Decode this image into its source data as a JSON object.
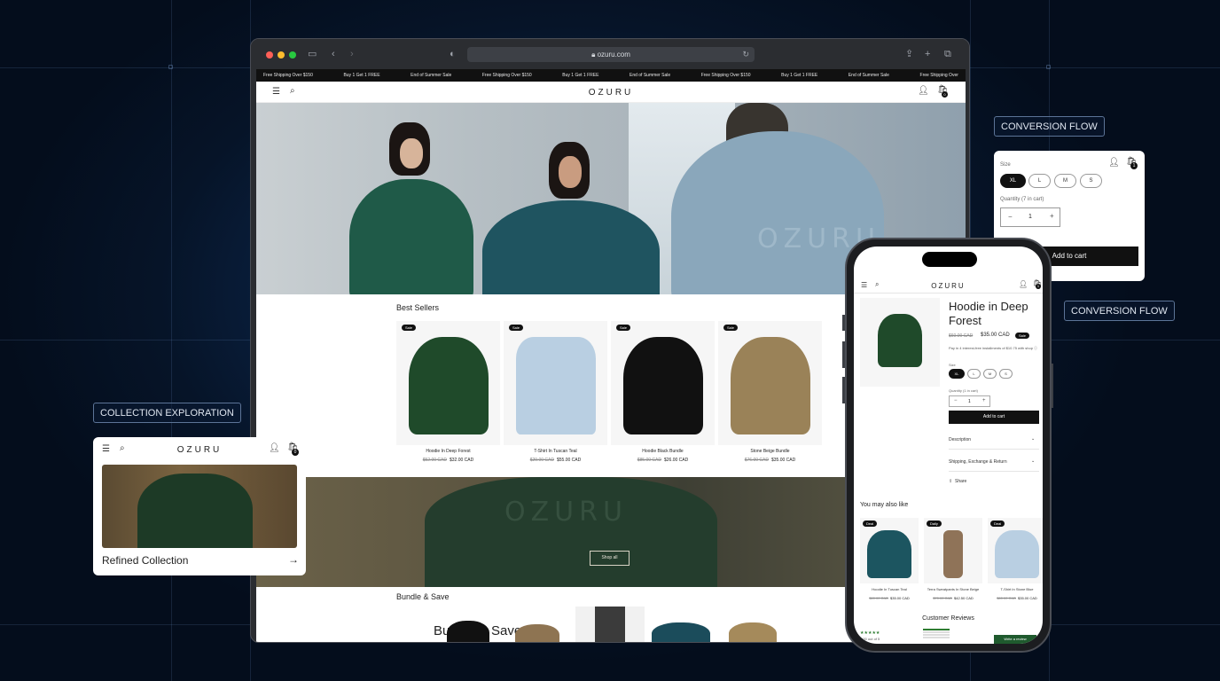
{
  "browser": {
    "url": "ozuru.com",
    "ticker": [
      "Free Shipping Over $150",
      "Buy 1 Get 1 FREE",
      "End of Summer Sale",
      "Free Shipping Over $150",
      "Buy 1 Get 1 FREE",
      "End of Summer Sale",
      "Free Shipping Over $150",
      "Buy 1 Get 1 FREE",
      "End of Summer Sale",
      "Free Shipping Over"
    ],
    "logo": "OZURU",
    "cart_count": "0",
    "hero_print": "OZURU",
    "best_sellers": {
      "title": "Best Sellers",
      "products": [
        {
          "badge": "Sale",
          "name": "Hoodie In Deep Forest",
          "old": "$52.00 CAD",
          "price": "$32.00 CAD",
          "color": "#1f4a2a"
        },
        {
          "badge": "Sale",
          "name": "T-Shirt In Tuscan Teal",
          "old": "$29.00 CAD",
          "price": "$55.00 CAD",
          "color": "#b9cfe2"
        },
        {
          "badge": "Sale",
          "name": "Hoodie Black Bundle",
          "old": "$85.00 CAD",
          "price": "$26.00 CAD",
          "color": "#111111"
        },
        {
          "badge": "Sale",
          "name": "Stone Beige Bundle",
          "old": "$76.00 CAD",
          "price": "$35.00 CAD",
          "color": "#9a8258"
        }
      ]
    },
    "banner_print": "OZURU",
    "shop_all": "Shop all",
    "bundle": {
      "title": "Bundle & Save",
      "heading": "Bundle & Save"
    }
  },
  "collection_card": {
    "label": "COLLECTION EXPLORATION",
    "logo": "OZURU",
    "cart_count": "0",
    "title": "Refined Collection"
  },
  "conversion_card": {
    "label": "CONVERSION FLOW",
    "cart_count": "1",
    "size_label": "Size",
    "sizes": [
      "XL",
      "L",
      "M",
      "S"
    ],
    "selected": "XL",
    "qty_label": "Quantity (7 in cart)",
    "qty": "1",
    "minus": "−",
    "plus": "+",
    "add_to_cart": "Add to cart"
  },
  "conversion_label_2": "CONVERSION FLOW",
  "phone": {
    "logo": "OZURU",
    "cart_count": "1",
    "title": "Hoodie in Deep Forest",
    "old_price": "$60.00 CAD",
    "price": "$35.00 CAD",
    "sale": "Sale",
    "installments": "Pay in 4 interest-free installments of $10.75 with shop ⓘ",
    "size_label": "Size",
    "sizes": [
      "XL",
      "L",
      "M",
      "S"
    ],
    "qty_label": "Quantity (1 in cart)",
    "qty": "1",
    "add_to_cart": "Add to cart",
    "description": "Description",
    "shipping": "Shipping, Exchange & Return",
    "share": "Share",
    "also_like": "You may also like",
    "related": [
      {
        "badge": "Deal",
        "name": "Hoodie In Tuscan Teal",
        "old": "$60.00 CAD",
        "price": "$35.00 CAD",
        "color": "#1c5560"
      },
      {
        "badge": "Daily",
        "name": "Terra Sweatpants In Stone Beige",
        "old": "$70.00 CAD",
        "price": "$42.50 CAD",
        "color": "#8f7358"
      },
      {
        "badge": "Deal",
        "name": "T-Shirt In Stone Blue",
        "old": "$60.00 CAD",
        "price": "$35.00 CAD",
        "color": "#b9cfe2"
      }
    ],
    "reviews_title": "Customer Reviews",
    "rating_text": "5.00 out of 5",
    "write_review": "Write a review"
  }
}
